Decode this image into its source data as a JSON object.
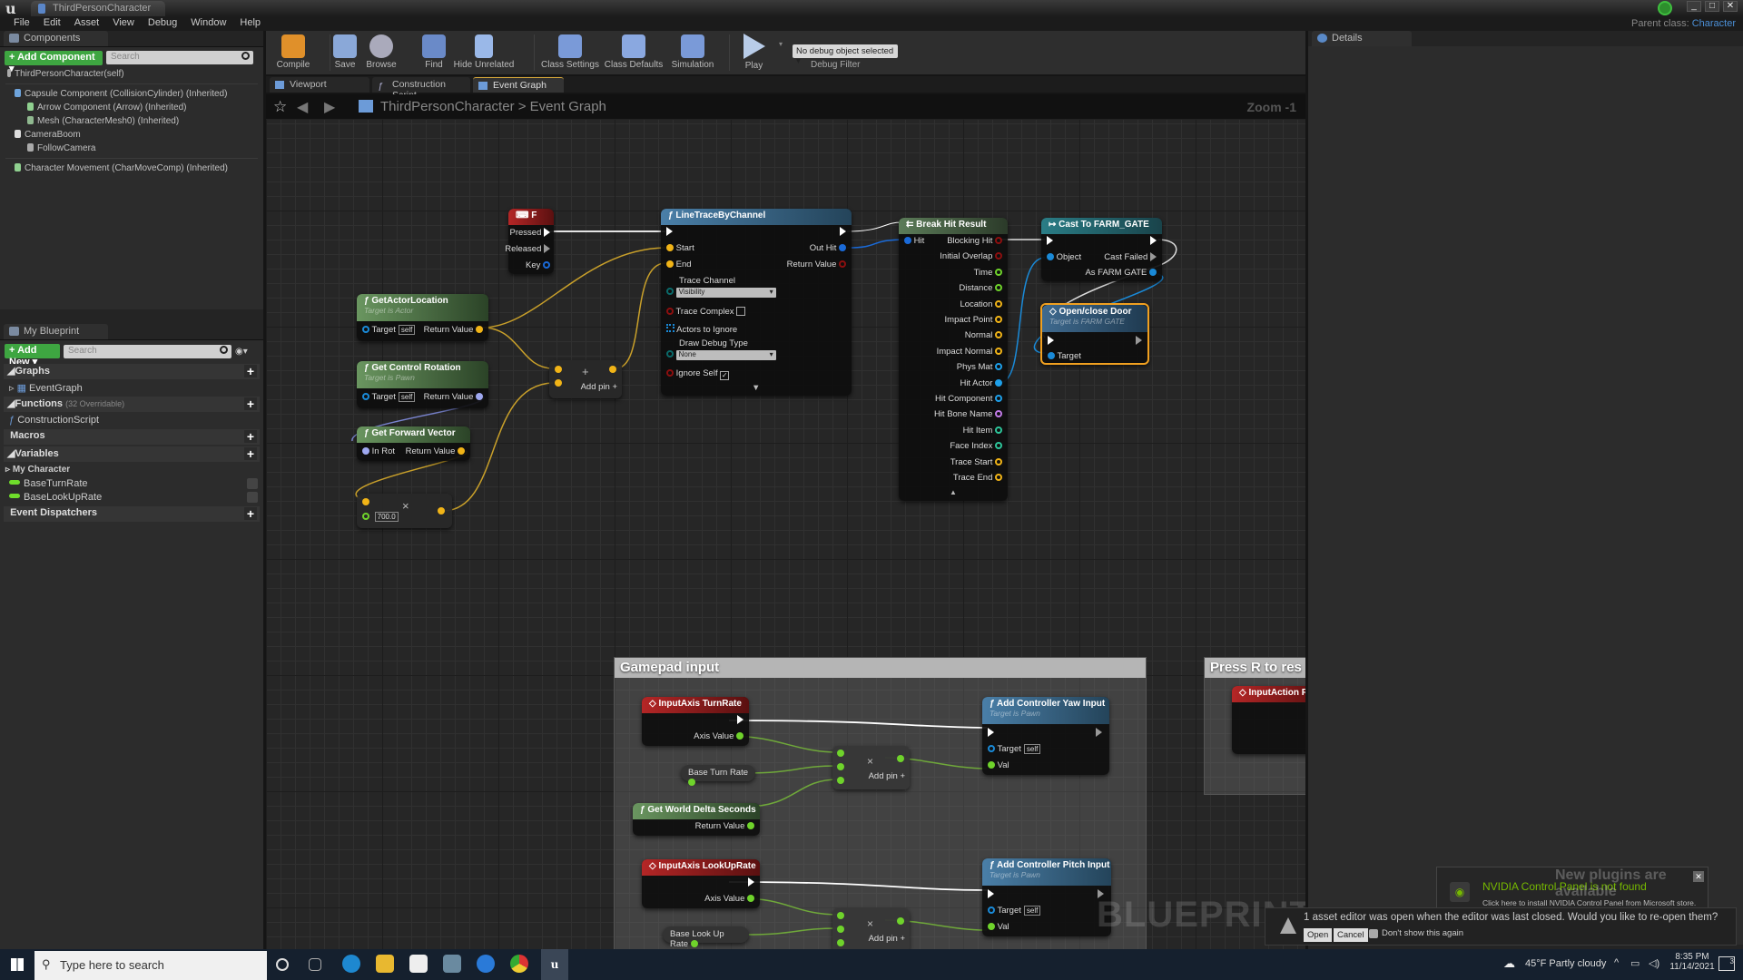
{
  "window": {
    "tab_title": "ThirdPersonCharacter",
    "parent_class_label": "Parent class:",
    "parent_class_value": "Character"
  },
  "menu": [
    "File",
    "Edit",
    "Asset",
    "View",
    "Debug",
    "Window",
    "Help"
  ],
  "components_panel": {
    "tab": "Components",
    "add_button": "+ Add Component ▾",
    "search_placeholder": "Search",
    "root": "ThirdPersonCharacter(self)",
    "items": [
      {
        "label": "Capsule Component (CollisionCylinder) (Inherited)",
        "depth": 1,
        "color": "#6ea4dc"
      },
      {
        "label": "Arrow Component (Arrow) (Inherited)",
        "depth": 2,
        "color": "#8fd08f"
      },
      {
        "label": "Mesh (CharacterMesh0) (Inherited)",
        "depth": 2,
        "color": "#8fb88f"
      },
      {
        "label": "CameraBoom",
        "depth": 1,
        "color": "#dddddd"
      },
      {
        "label": "FollowCamera",
        "depth": 2,
        "color": "#aaaaaa"
      },
      {
        "label": "Character Movement (CharMoveComp) (Inherited)",
        "depth": 1,
        "color": "#8fd08f"
      }
    ]
  },
  "my_blueprint": {
    "tab": "My Blueprint",
    "add_button": "+ Add New ▾",
    "search_placeholder": "Search",
    "graphs_label": "Graphs",
    "event_graph": "EventGraph",
    "functions_label": "Functions",
    "functions_note": "(32 Overridable)",
    "construction_script": "ConstructionScript",
    "macros_label": "Macros",
    "variables_label": "Variables",
    "var_category": "My Character",
    "variables": [
      "BaseTurnRate",
      "BaseLookUpRate"
    ],
    "dispatchers_label": "Event Dispatchers"
  },
  "toolbar": {
    "buttons": [
      "Compile",
      "Save",
      "Browse",
      "Find",
      "Hide Unrelated",
      "Class Settings",
      "Class Defaults",
      "Simulation",
      "Play"
    ],
    "debug_select": "No debug object selected ▾",
    "debug_label": "Debug Filter"
  },
  "graph_tabs": [
    "Viewport",
    "Construction Script",
    "Event Graph"
  ],
  "graph": {
    "breadcrumb_root": "ThirdPersonCharacter",
    "breadcrumb_sep": ">",
    "breadcrumb_current": "Event Graph",
    "zoom": "Zoom -1",
    "watermark": "BLUEPRINT"
  },
  "nodes": {
    "key_f": {
      "title": "F",
      "pins": [
        "Pressed",
        "Released",
        "Key"
      ]
    },
    "get_actor_location": {
      "title": "GetActorLocation",
      "subtitle": "Target is Actor",
      "target": "Target",
      "self": "self",
      "ret": "Return Value"
    },
    "get_control_rotation": {
      "title": "Get Control Rotation",
      "subtitle": "Target is Pawn",
      "target": "Target",
      "self": "self",
      "ret": "Return Value"
    },
    "get_forward_vector": {
      "title": "Get Forward Vector",
      "in": "In Rot",
      "ret": "Return Value"
    },
    "multiply": {
      "value": "700.0",
      "op": "×"
    },
    "add": {
      "op": "+",
      "add_pin": "Add pin +"
    },
    "line_trace": {
      "title": "LineTraceByChannel",
      "start": "Start",
      "end": "End",
      "out_hit": "Out Hit",
      "ret": "Return Value",
      "trace_channel": "Trace Channel",
      "trace_channel_value": "Visibility",
      "trace_complex": "Trace Complex",
      "actors_ignore": "Actors to Ignore",
      "draw_debug": "Draw Debug Type",
      "draw_debug_value": "None",
      "ignore_self": "Ignore Self",
      "trace_complex_checked": false,
      "ignore_self_checked": true
    },
    "break_hit": {
      "title": "Break Hit Result",
      "in": "Hit",
      "outs": [
        {
          "label": "Blocking Hit",
          "color": "#8c0f0f"
        },
        {
          "label": "Initial Overlap",
          "color": "#8c0f0f"
        },
        {
          "label": "Time",
          "color": "#6fd32b"
        },
        {
          "label": "Distance",
          "color": "#6fd32b"
        },
        {
          "label": "Location",
          "color": "#f1b417"
        },
        {
          "label": "Impact Point",
          "color": "#f1b417"
        },
        {
          "label": "Normal",
          "color": "#f1b417"
        },
        {
          "label": "Impact Normal",
          "color": "#f1b417"
        },
        {
          "label": "Phys Mat",
          "color": "#1ea0ea"
        },
        {
          "label": "Hit Actor",
          "color": "#1ea0ea"
        },
        {
          "label": "Hit Component",
          "color": "#1ea0ea"
        },
        {
          "label": "Hit Bone Name",
          "color": "#c27be8"
        },
        {
          "label": "Hit Item",
          "color": "#2dc59a"
        },
        {
          "label": "Face Index",
          "color": "#2dc59a"
        },
        {
          "label": "Trace Start",
          "color": "#f1b417"
        },
        {
          "label": "Trace End",
          "color": "#f1b417"
        }
      ]
    },
    "cast": {
      "title": "Cast To FARM_GATE",
      "object": "Object",
      "cast_failed": "Cast Failed",
      "as": "As FARM GATE"
    },
    "open_door": {
      "title": "Open/close Door",
      "subtitle": "Target is FARM GATE",
      "target": "Target"
    },
    "gamepad_comment": "Gamepad input",
    "press_r_comment": "Press R to res",
    "turn_rate": {
      "title": "InputAxis TurnRate",
      "axis": "Axis Value"
    },
    "base_turn_rate": "Base Turn Rate",
    "world_delta": {
      "title": "Get World Delta Seconds",
      "ret": "Return Value"
    },
    "yaw": {
      "title": "Add Controller Yaw Input",
      "subtitle": "Target is Pawn",
      "target": "Target",
      "self": "self",
      "val": "Val"
    },
    "mult_pin": "Add pin +",
    "lookup_rate": {
      "title": "InputAxis LookUpRate",
      "axis": "Axis Value"
    },
    "base_lookup_rate": "Base Look Up Rate",
    "pitch": {
      "title": "Add Controller Pitch Input",
      "subtitle": "Target is Pawn",
      "target": "Target",
      "self": "self",
      "val": "Val"
    },
    "input_action": {
      "title": "InputAction Re"
    }
  },
  "details": {
    "tab": "Details"
  },
  "notifications": {
    "nvidia_title": "NVIDIA Control Panel is not found",
    "nvidia_body": "Click here to install NVIDIA Control Panel from Microsoft store.",
    "plugins": "New plugins are available",
    "asset_msg": "1 asset editor was open when the editor was last closed. Would you like to re-open them?",
    "open": "Open",
    "cancel": "Cancel",
    "dont_show": "Don't show this again"
  },
  "taskbar": {
    "search_placeholder": "Type here to search",
    "weather": "45°F  Partly cloudy",
    "time": "8:35 PM",
    "date": "11/14/2021",
    "notif_count": "3"
  }
}
